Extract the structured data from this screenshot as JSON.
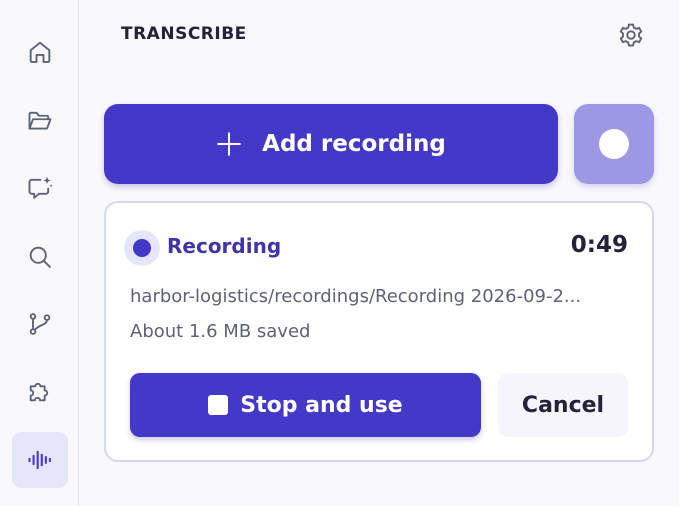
{
  "sidebar": {
    "items": [
      {
        "icon": "home-icon",
        "active": false
      },
      {
        "icon": "folder-icon",
        "active": false
      },
      {
        "icon": "ai-chat-icon",
        "active": false
      },
      {
        "icon": "search-icon",
        "active": false
      },
      {
        "icon": "git-branch-icon",
        "active": false
      },
      {
        "icon": "puzzle-icon",
        "active": false
      },
      {
        "icon": "waveform-icon",
        "active": true
      }
    ]
  },
  "header": {
    "title": "TRANSCRIBE",
    "settings_icon": "gear-icon"
  },
  "actions": {
    "add_recording_label": "Add recording",
    "record_button_icon": "record-dot-icon"
  },
  "recording_card": {
    "status": "Recording",
    "elapsed": "0:49",
    "file_path": "harbor-logistics/recordings/Recording 2026-09-2...",
    "size_note": "About 1.6 MB saved",
    "stop_label": "Stop and use",
    "cancel_label": "Cancel"
  },
  "colors": {
    "accent": "#4438c8",
    "accent_light": "#9d98e3",
    "background": "#f8f8fd"
  }
}
